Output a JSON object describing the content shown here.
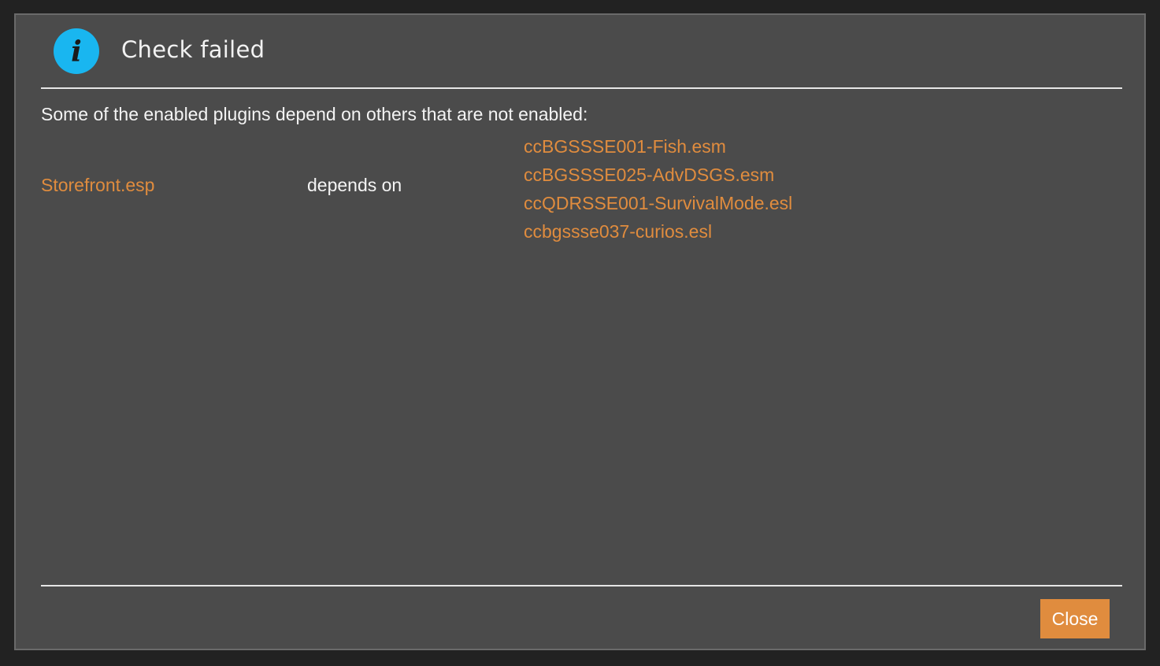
{
  "dialog": {
    "icon": "info-icon",
    "icon_glyph": "i",
    "icon_color": "#19b6f0",
    "title": "Check failed"
  },
  "body": {
    "message": "Some of the enabled plugins depend on others that are not enabled:",
    "entries": [
      {
        "plugin": "Storefront.esp",
        "relation": "depends on",
        "dependencies": [
          "ccBGSSSE001-Fish.esm",
          "ccBGSSSE025-AdvDSGS.esm",
          "ccQDRSSE001-SurvivalMode.esl",
          "ccbgssse037-curios.esl"
        ]
      }
    ]
  },
  "footer": {
    "close_label": "Close"
  },
  "colors": {
    "accent": "#e08c3e",
    "dialog_background": "#4b4b4b",
    "text": "#f4f4f4"
  }
}
